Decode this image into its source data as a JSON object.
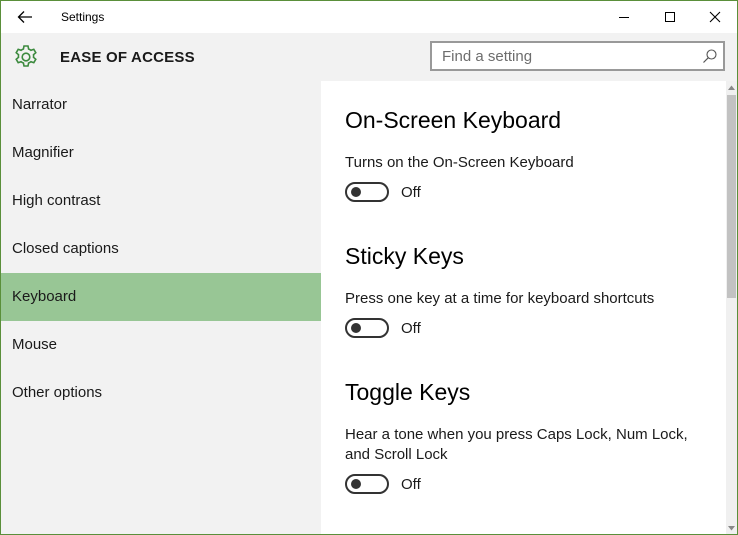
{
  "window": {
    "title": "Settings"
  },
  "header": {
    "section_title": "EASE OF ACCESS",
    "search_placeholder": "Find a setting"
  },
  "sidebar": {
    "items": [
      {
        "label": "Narrator",
        "selected": false
      },
      {
        "label": "Magnifier",
        "selected": false
      },
      {
        "label": "High contrast",
        "selected": false
      },
      {
        "label": "Closed captions",
        "selected": false
      },
      {
        "label": "Keyboard",
        "selected": true
      },
      {
        "label": "Mouse",
        "selected": false
      },
      {
        "label": "Other options",
        "selected": false
      }
    ]
  },
  "content": {
    "sections": [
      {
        "heading": "On-Screen Keyboard",
        "description": "Turns on the On-Screen Keyboard",
        "toggle_state": "Off"
      },
      {
        "heading": "Sticky Keys",
        "description": "Press one key at a time for keyboard shortcuts",
        "toggle_state": "Off"
      },
      {
        "heading": "Toggle Keys",
        "description": "Hear a tone when you press Caps Lock, Num Lock, and Scroll Lock",
        "toggle_state": "Off"
      }
    ]
  },
  "colors": {
    "accent": "#98c695",
    "window_border": "#5a8f3a",
    "gear": "#3c8a3e"
  },
  "icons": {
    "back": "back-arrow-icon",
    "minimize": "minimize-icon",
    "maximize": "maximize-icon",
    "close": "close-icon",
    "header": "gear-icon",
    "search": "search-icon"
  }
}
